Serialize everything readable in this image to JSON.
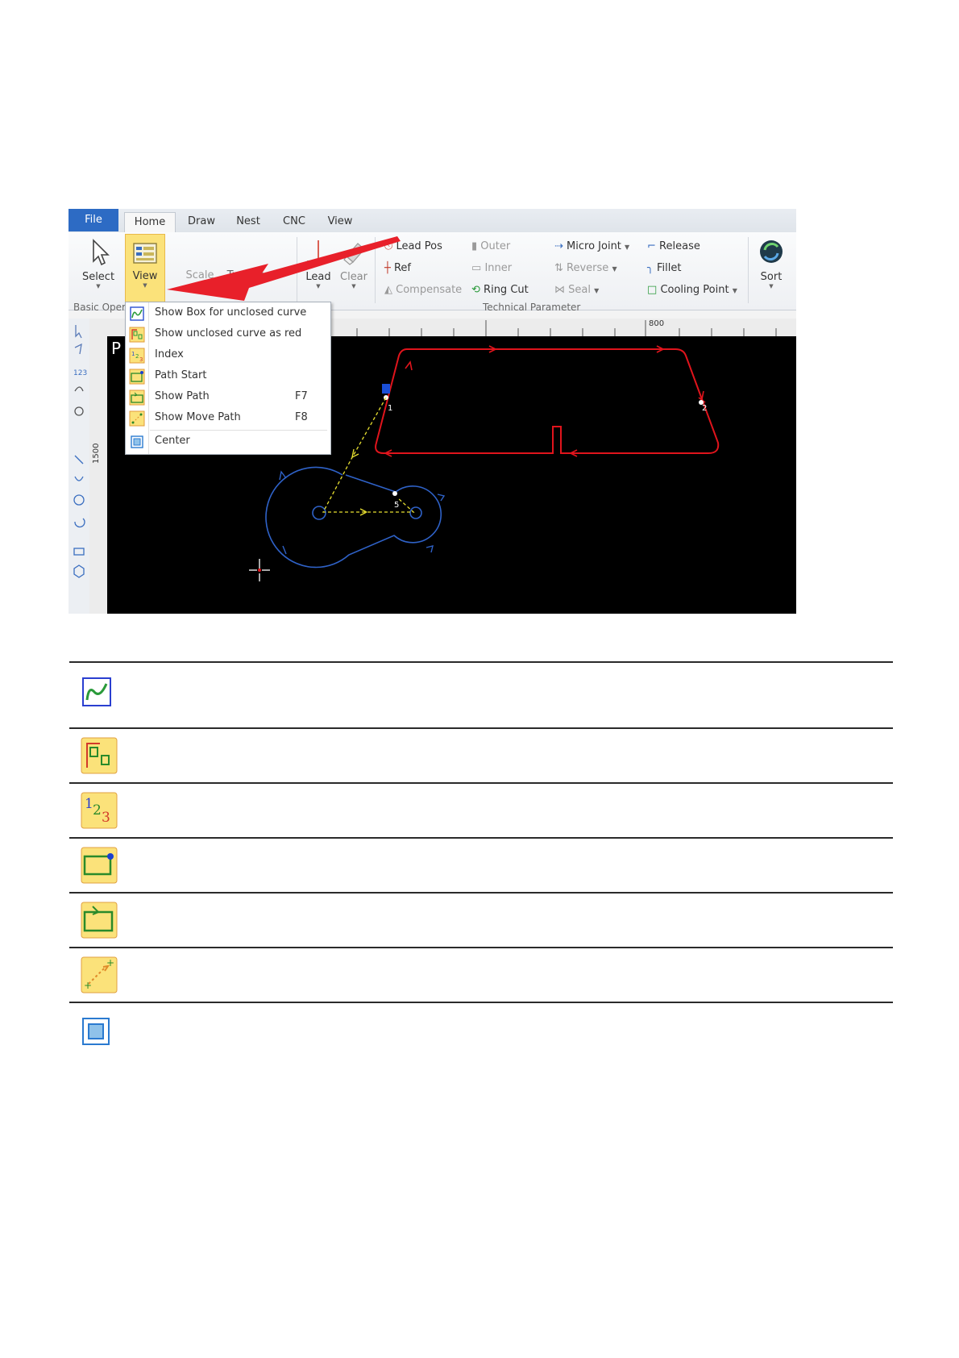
{
  "tabs": [
    {
      "label": "File"
    },
    {
      "label": "Home"
    },
    {
      "label": "Draw"
    },
    {
      "label": "Nest"
    },
    {
      "label": "CNC"
    },
    {
      "label": "View"
    }
  ],
  "ribbon": {
    "select": "Select",
    "view": "View",
    "scale": "Scale",
    "transform": "Transform",
    "lead": "Lead",
    "clear": "Clear",
    "lead_pos": "Lead Pos",
    "ref": "Ref",
    "compensate": "Compensate",
    "outer": "Outer",
    "inner": "Inner",
    "ring_cut": "Ring Cut",
    "micro_joint": "Micro Joint",
    "reverse": "Reverse",
    "seal": "Seal",
    "release": "Release",
    "fillet": "Fillet",
    "cooling_point": "Cooling Point",
    "sort": "Sort",
    "group_basic": "Basic Oper",
    "group_technical": "Technical Parameter"
  },
  "ruler": {
    "mark": "800",
    "v_mark": "1500"
  },
  "canvas": {
    "partial_label": "P",
    "path_labels": [
      "1",
      "2",
      "5"
    ]
  },
  "view_menu": {
    "items": [
      {
        "label": "Show Box for unclosed curve",
        "shortcut": "",
        "icon": "unclosed-curve-box-icon"
      },
      {
        "label": "Show unclosed curve as red",
        "shortcut": "",
        "icon": "unclosed-curve-red-icon"
      },
      {
        "label": "Index",
        "shortcut": "",
        "icon": "index-icon"
      },
      {
        "label": "Path Start",
        "shortcut": "",
        "icon": "path-start-icon"
      },
      {
        "label": "Show Path",
        "shortcut": "F7",
        "icon": "show-path-icon"
      },
      {
        "label": "Show Move Path",
        "shortcut": "F8",
        "icon": "show-move-path-icon"
      },
      {
        "label": "Center",
        "shortcut": "",
        "icon": "center-icon"
      }
    ]
  },
  "colors": {
    "accent": "#2d6bc4",
    "highlight": "#fbe27a",
    "path_red": "#e0141c",
    "path_blue": "#2f62c8",
    "move_yellow": "#e8e030",
    "arrow": "#e8202a"
  },
  "icon_table": [
    {
      "icon": "unclosed-curve-box-icon"
    },
    {
      "icon": "unclosed-curve-red-icon"
    },
    {
      "icon": "index-icon"
    },
    {
      "icon": "path-start-icon"
    },
    {
      "icon": "show-path-icon"
    },
    {
      "icon": "show-move-path-icon"
    },
    {
      "icon": "center-icon"
    }
  ]
}
